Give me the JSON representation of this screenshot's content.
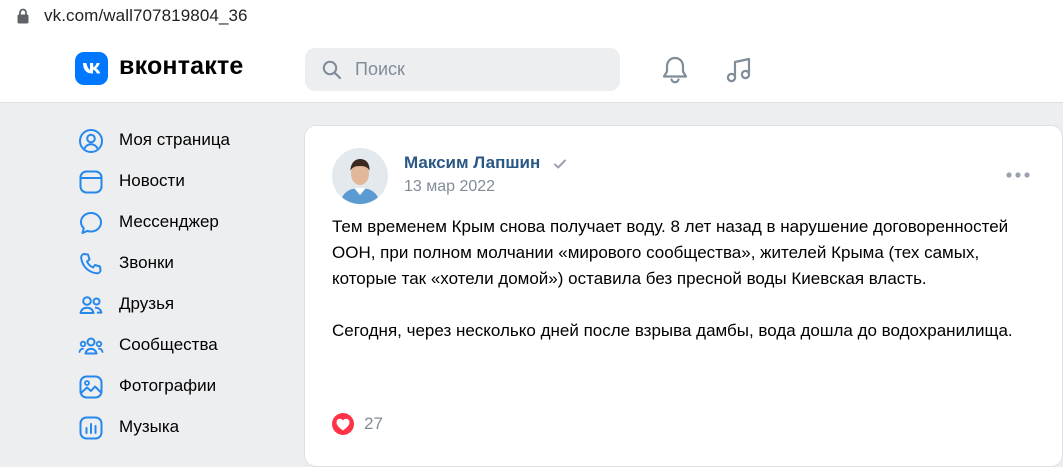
{
  "browser": {
    "url": "vk.com/wall707819804_36"
  },
  "header": {
    "logo_text": "вконтакте",
    "search_placeholder": "Поиск",
    "icons": [
      "bell-icon",
      "music-note-icon"
    ]
  },
  "sidebar": {
    "items": [
      {
        "label": "Моя страница",
        "icon": "profile-icon"
      },
      {
        "label": "Новости",
        "icon": "news-icon"
      },
      {
        "label": "Мессенджер",
        "icon": "messenger-icon"
      },
      {
        "label": "Звонки",
        "icon": "phone-icon"
      },
      {
        "label": "Друзья",
        "icon": "friends-icon"
      },
      {
        "label": "Сообщества",
        "icon": "communities-icon"
      },
      {
        "label": "Фотографии",
        "icon": "photos-icon"
      },
      {
        "label": "Музыка",
        "icon": "music-icon"
      }
    ]
  },
  "post": {
    "author": "Максим Лапшин",
    "date": "13 мар 2022",
    "paragraphs": [
      "Тем временем Крым снова получает воду. 8 лет назад в нарушение договоренностей ООН, при полном молчании «мирового сообщества», жителей Крыма (тех самых, которые так «хотели домой») оставила без пресной воды Киевская власть.",
      "Сегодня, через несколько дней после взрыва дамбы, вода дошла до водохранилища."
    ],
    "likes": "27"
  },
  "colors": {
    "accent": "#0077ff",
    "author_link": "#2a5885",
    "secondary_text": "#818c99",
    "like_red": "#ff3347",
    "page_bg": "#edeef0"
  }
}
